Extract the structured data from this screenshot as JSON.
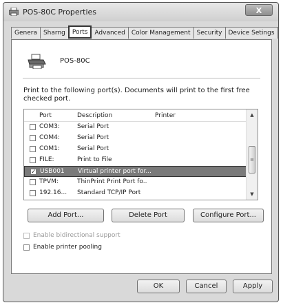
{
  "window": {
    "title": "POS-80C Properties",
    "close_label": "X"
  },
  "tabs": [
    {
      "label": "Genera"
    },
    {
      "label": "Sharng"
    },
    {
      "label": "Ports"
    },
    {
      "label": "Advanced"
    },
    {
      "label": "Color Management"
    },
    {
      "label": "Security"
    },
    {
      "label": "Device Setings"
    }
  ],
  "printer": {
    "name": "POS-80C"
  },
  "instructions": "Print to the following port(s). Documents will print to the first free checked port.",
  "port_list": {
    "columns": {
      "port": "Port",
      "description": "Description",
      "printer": "Printer"
    },
    "rows": [
      {
        "checked": "",
        "port": "COM3:",
        "description": "Serial Port"
      },
      {
        "checked": "",
        "port": "COM4:",
        "description": "Serial Port"
      },
      {
        "checked": "",
        "port": "COM1:",
        "description": "Serial Port"
      },
      {
        "checked": "",
        "port": "FILE:",
        "description": "Print to File"
      },
      {
        "checked": "✓",
        "port": "USB001",
        "description": "Virtual printer port for...",
        "selected": true
      },
      {
        "checked": "",
        "port": "TPVM:",
        "description": "ThinPrint Print Port fo.."
      },
      {
        "checked": "",
        "port": "192.16...",
        "description": "Standard TCP/IP Port"
      }
    ],
    "scroll": {
      "up": "▲",
      "down": "▼",
      "thumb": "≡"
    }
  },
  "buttons": {
    "add_port": "Add Port...",
    "delete_port": "Delete Port",
    "configure_port": "Configure Port...",
    "ok": "OK",
    "cancel": "Cancel",
    "apply": "Apply"
  },
  "options": {
    "bidirectional": "Enable bidirectional support",
    "spooling": "Enable printer pooling"
  }
}
